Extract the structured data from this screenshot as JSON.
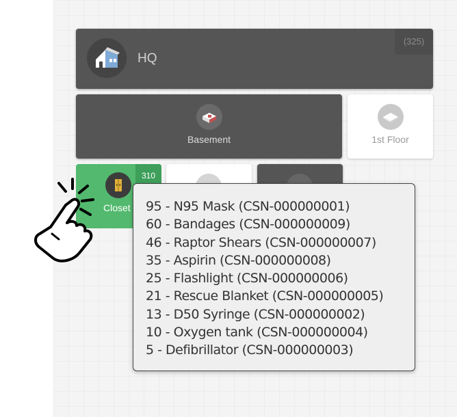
{
  "hq": {
    "title": "HQ",
    "count": "(325)",
    "icon": "building-icon"
  },
  "floors": [
    {
      "label": "Basement",
      "icon": "room-icon"
    },
    {
      "label": "1st Floor",
      "icon": "floor-plan-icon"
    }
  ],
  "rooms": [
    {
      "label": "Closet",
      "count": "310",
      "icon": "cabinet-icon"
    },
    {
      "icon": "room-icon"
    },
    {
      "icon": "room-icon"
    }
  ],
  "tooltip": {
    "items": [
      "95 - N95 Mask (CSN-000000001)",
      "60 - Bandages (CSN-000000009)",
      "46 - Raptor Shears (CSN-000000007)",
      "35 - Aspirin (CSN-000000008)",
      "25 - Flashlight (CSN-000000006)",
      "21 - Rescue Blanket (CSN-000000005)",
      "13 - D50 Syringe (CSN-000000002)",
      "10 - Oxygen tank (CSN-000000004)",
      "5 - Defibrillator (CSN-000000003)"
    ]
  },
  "colors": {
    "tile_dark": "#555555",
    "tile_light": "#ffffff",
    "tile_selected": "#52b96e",
    "tooltip_bg": "#efefef"
  },
  "cursor": {
    "icon": "pointing-hand-click-icon"
  }
}
